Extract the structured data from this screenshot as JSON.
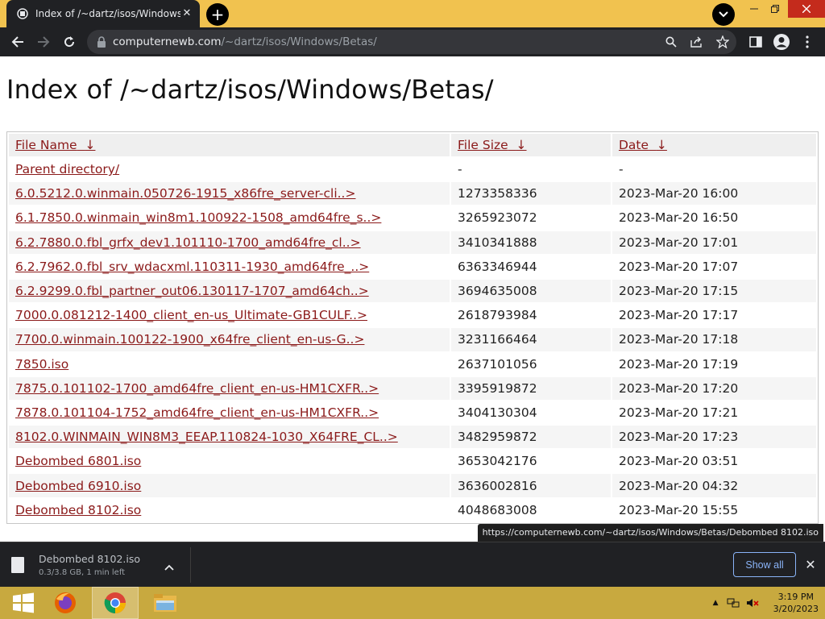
{
  "browser": {
    "tab_title": "Index of /~dartz/isos/Windows/B",
    "url_domain": "computernewb.com",
    "url_path": "/~dartz/isos/Windows/Betas/",
    "status_url": "https://computernewb.com/~dartz/isos/Windows/Betas/Debombed 8102.iso"
  },
  "page": {
    "heading": "Index of /~dartz/isos/Windows/Betas/",
    "columns": {
      "name": "File Name",
      "size": "File Size",
      "date": "Date",
      "sort_arrow": "↓"
    },
    "rows": [
      {
        "name": "Parent directory/",
        "size": "-",
        "date": "-"
      },
      {
        "name": "6.0.5212.0.winmain.050726-1915_x86fre_server-cli..>",
        "size": "1273358336",
        "date": "2023-Mar-20 16:00"
      },
      {
        "name": "6.1.7850.0.winmain_win8m1.100922-1508_amd64fre_s..>",
        "size": "3265923072",
        "date": "2023-Mar-20 16:50"
      },
      {
        "name": "6.2.7880.0.fbl_grfx_dev1.101110-1700_amd64fre_cl..>",
        "size": "3410341888",
        "date": "2023-Mar-20 17:01"
      },
      {
        "name": "6.2.7962.0.fbl_srv_wdacxml.110311-1930_amd64fre_..>",
        "size": "6363346944",
        "date": "2023-Mar-20 17:07"
      },
      {
        "name": "6.2.9299.0.fbl_partner_out06.130117-1707_amd64ch..>",
        "size": "3694635008",
        "date": "2023-Mar-20 17:15"
      },
      {
        "name": "7000.0.081212-1400_client_en-us_Ultimate-GB1CULF..>",
        "size": "2618793984",
        "date": "2023-Mar-20 17:17"
      },
      {
        "name": "7700.0.winmain.100122-1900_x64fre_client_en-us-G..>",
        "size": "3231166464",
        "date": "2023-Mar-20 17:18"
      },
      {
        "name": "7850.iso",
        "size": "2637101056",
        "date": "2023-Mar-20 17:19"
      },
      {
        "name": "7875.0.101102-1700_amd64fre_client_en-us-HM1CXFR..>",
        "size": "3395919872",
        "date": "2023-Mar-20 17:20"
      },
      {
        "name": "7878.0.101104-1752_amd64fre_client_en-us-HM1CXFR..>",
        "size": "3404130304",
        "date": "2023-Mar-20 17:21"
      },
      {
        "name": "8102.0.WINMAIN_WIN8M3_EEAP.110824-1030_X64FRE_CL..>",
        "size": "3482959872",
        "date": "2023-Mar-20 17:23"
      },
      {
        "name": "Debombed 6801.iso",
        "size": "3653042176",
        "date": "2023-Mar-20 03:51"
      },
      {
        "name": "Debombed 6910.iso",
        "size": "3636002816",
        "date": "2023-Mar-20 04:32"
      },
      {
        "name": "Debombed 8102.iso",
        "size": "4048683008",
        "date": "2023-Mar-20 15:55"
      }
    ]
  },
  "download_shelf": {
    "file_name": "Debombed 8102.iso",
    "status": "0.3/3.8 GB, 1 min left",
    "show_all": "Show all"
  },
  "taskbar": {
    "time": "3:19 PM",
    "date": "3/20/2023"
  },
  "colors": {
    "titlebar": "#f1c24f",
    "link": "#8b1a1a",
    "taskbar": "#c8a93f"
  }
}
